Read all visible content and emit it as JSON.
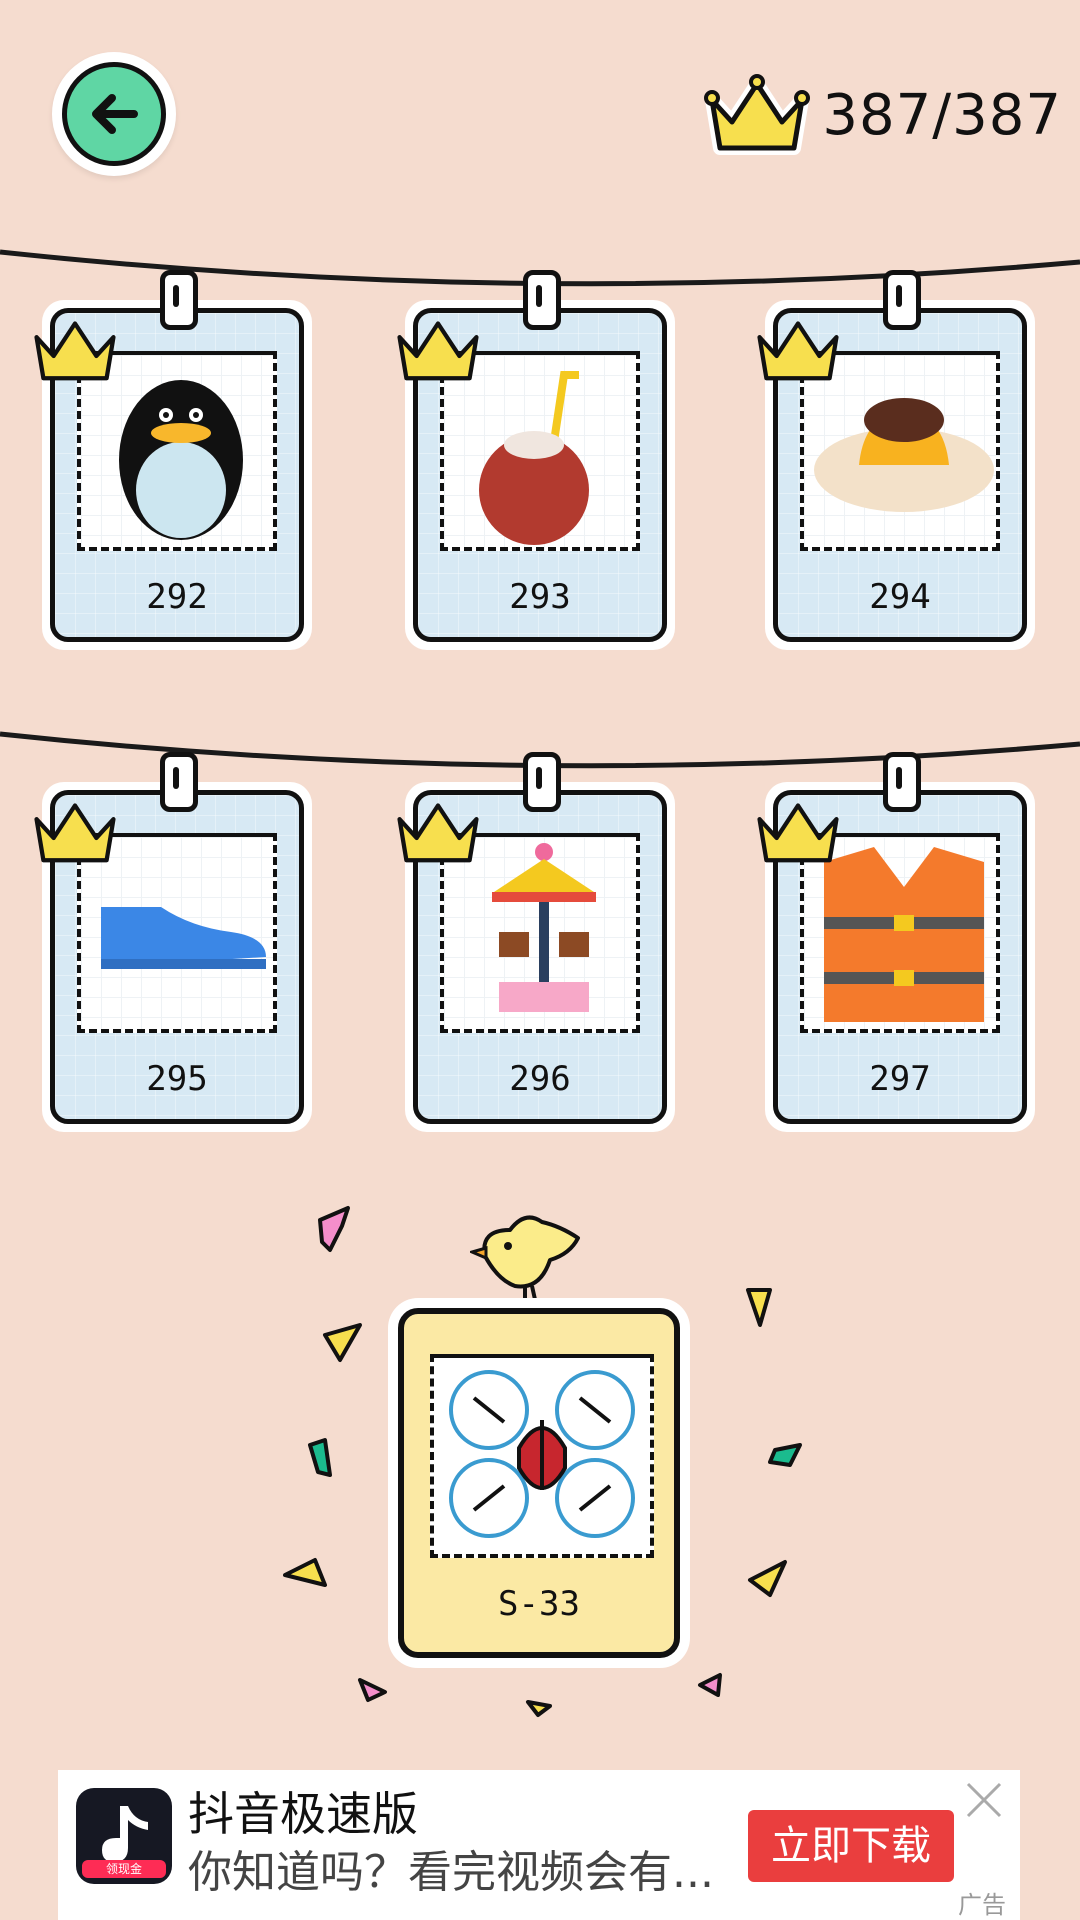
{
  "score": {
    "count": "387/387"
  },
  "cards": [
    {
      "id": "292",
      "item": "penguin"
    },
    {
      "id": "293",
      "item": "coconut"
    },
    {
      "id": "294",
      "item": "pudding"
    },
    {
      "id": "295",
      "item": "sneaker"
    },
    {
      "id": "296",
      "item": "carousel"
    },
    {
      "id": "297",
      "item": "life-vest"
    }
  ],
  "featured": {
    "id": "S-33",
    "item": "drone"
  },
  "ad": {
    "app_name": "抖音极速版",
    "description": "你知道吗？看完视频会有...",
    "icon_tag": "领现金",
    "cta": "立即下载",
    "ad_label": "广告"
  },
  "colors": {
    "background": "#f5dccf",
    "back_button": "#5fd6a4",
    "crown": "#f7df4e",
    "card_blue": "#d7e9f4",
    "card_yellow": "#fbe9a4",
    "cta_red": "#ea3e3e"
  }
}
